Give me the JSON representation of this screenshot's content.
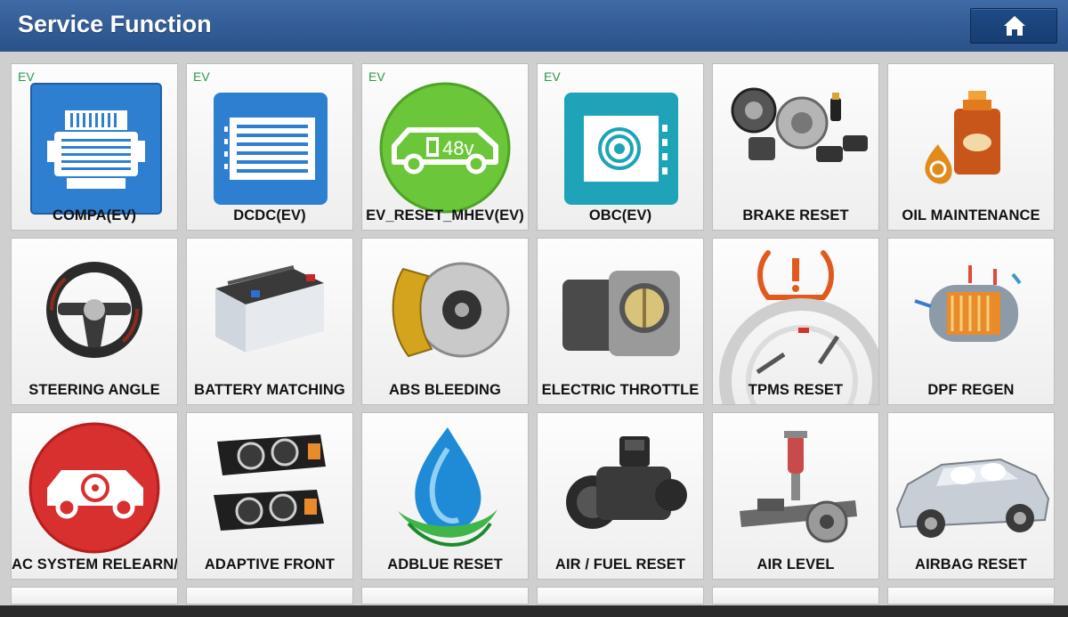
{
  "header": {
    "title": "Service Function",
    "home_icon": "home-icon"
  },
  "tiles": [
    {
      "label": "COMPA(EV)",
      "badge": "EV",
      "icon": "ev-compressor-icon"
    },
    {
      "label": "DCDC(EV)",
      "badge": "EV",
      "icon": "ev-dcdc-icon"
    },
    {
      "label": "EV_RESET_MHEV(EV)",
      "badge": "EV",
      "icon": "ev-48v-car-icon",
      "icon_text": "48v"
    },
    {
      "label": "OBC(EV)",
      "badge": "EV",
      "icon": "ev-obc-icon"
    },
    {
      "label": "BRAKE RESET",
      "icon": "brake-parts-icon"
    },
    {
      "label": "OIL MAINTENANCE",
      "icon": "oil-can-icon"
    },
    {
      "label": "STEERING ANGLE",
      "icon": "steering-wheel-icon"
    },
    {
      "label": "BATTERY MATCHING",
      "icon": "car-battery-icon"
    },
    {
      "label": "ABS BLEEDING",
      "icon": "brake-caliper-icon"
    },
    {
      "label": "ELECTRIC THROTTLE",
      "icon": "throttle-body-icon"
    },
    {
      "label": "TPMS RESET",
      "icon": "tire-pressure-icon"
    },
    {
      "label": "DPF REGEN",
      "icon": "particulate-filter-icon"
    },
    {
      "label": "AC SYSTEM RELEARN/",
      "icon": "ac-relearn-car-icon"
    },
    {
      "label": "ADAPTIVE FRONT",
      "icon": "headlights-icon"
    },
    {
      "label": "ADBLUE RESET",
      "icon": "adblue-drop-icon"
    },
    {
      "label": "AIR / FUEL RESET",
      "icon": "airflow-sensor-icon"
    },
    {
      "label": "AIR LEVEL",
      "icon": "air-suspension-icon"
    },
    {
      "label": "AIRBAG RESET",
      "icon": "airbag-car-icon"
    }
  ],
  "colors": {
    "header": "#2f5a96",
    "ev_badge": "#2a9a4a",
    "ev_blue": "#2f7fd0",
    "ev_green": "#6cc63a",
    "ev_teal": "#1fa3b8",
    "alert_red": "#d82f2f"
  }
}
